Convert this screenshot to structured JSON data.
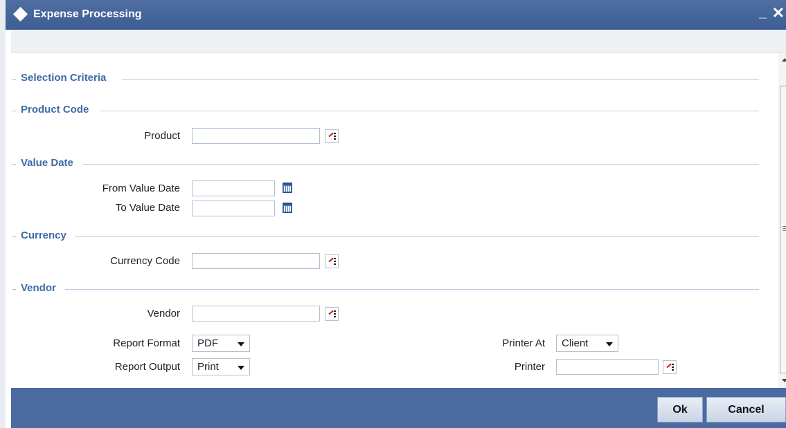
{
  "window": {
    "title": "Expense Processing",
    "minimize_label": "_",
    "close_label": "✕"
  },
  "sections": {
    "selection": "Selection Criteria",
    "product_code": "Product Code",
    "value_date": "Value Date",
    "currency": "Currency",
    "vendor": "Vendor"
  },
  "fields": {
    "product": {
      "label": "Product",
      "value": ""
    },
    "from_value_date": {
      "label": "From Value Date",
      "value": ""
    },
    "to_value_date": {
      "label": "To Value Date",
      "value": ""
    },
    "currency_code": {
      "label": "Currency Code",
      "value": ""
    },
    "vendor": {
      "label": "Vendor",
      "value": ""
    },
    "report_format": {
      "label": "Report Format",
      "selected": "PDF"
    },
    "report_output": {
      "label": "Report Output",
      "selected": "Print"
    },
    "printer_at": {
      "label": "Printer At",
      "selected": "Client"
    },
    "printer": {
      "label": "Printer",
      "value": ""
    }
  },
  "buttons": {
    "ok": "Ok",
    "cancel": "Cancel"
  },
  "icons": {
    "title": "diamond-icon",
    "lov": "list-of-values-icon",
    "calendar": "calendar-icon"
  },
  "colors": {
    "titlebar": "#3f6096",
    "section_heading": "#3e6aa6",
    "footer": "#4a6aa0"
  }
}
